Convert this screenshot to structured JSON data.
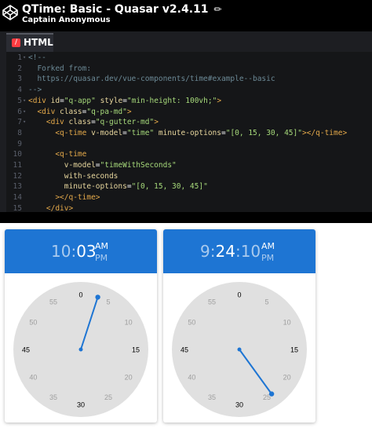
{
  "header": {
    "title": "QTime: Basic - Quasar v2.4.11",
    "author": "Captain Anonymous",
    "logo_icon": "codepen-logo-icon",
    "edit_icon": "pencil-icon"
  },
  "editor": {
    "tab_label": "HTML",
    "tab_badge": "/",
    "lines": [
      {
        "n": "1",
        "fold": true,
        "segments": [
          {
            "c": "c-comment",
            "t": "<!--"
          }
        ]
      },
      {
        "n": "2",
        "fold": false,
        "segments": [
          {
            "c": "c-comment",
            "t": "  Forked from:"
          }
        ]
      },
      {
        "n": "3",
        "fold": false,
        "segments": [
          {
            "c": "c-comment",
            "t": "  https://quasar.dev/vue-components/time#example--basic"
          }
        ]
      },
      {
        "n": "4",
        "fold": false,
        "segments": [
          {
            "c": "c-comment",
            "t": "-->"
          }
        ]
      },
      {
        "n": "5",
        "fold": true,
        "segments": [
          {
            "c": "c-tag",
            "t": "<div "
          },
          {
            "c": "c-attr",
            "t": "id"
          },
          {
            "c": "c-text",
            "t": "="
          },
          {
            "c": "c-str",
            "t": "\"q-app\""
          },
          {
            "c": "c-text",
            "t": " "
          },
          {
            "c": "c-attr",
            "t": "style"
          },
          {
            "c": "c-text",
            "t": "="
          },
          {
            "c": "c-str",
            "t": "\"min-height: 100vh;\""
          },
          {
            "c": "c-tag",
            "t": ">"
          }
        ]
      },
      {
        "n": "6",
        "fold": true,
        "segments": [
          {
            "c": "c-tag",
            "t": "  <div "
          },
          {
            "c": "c-attr",
            "t": "class"
          },
          {
            "c": "c-text",
            "t": "="
          },
          {
            "c": "c-str",
            "t": "\"q-pa-md\""
          },
          {
            "c": "c-tag",
            "t": ">"
          }
        ]
      },
      {
        "n": "7",
        "fold": true,
        "segments": [
          {
            "c": "c-tag",
            "t": "    <div "
          },
          {
            "c": "c-attr",
            "t": "class"
          },
          {
            "c": "c-text",
            "t": "="
          },
          {
            "c": "c-str",
            "t": "\"q-gutter-md\""
          },
          {
            "c": "c-tag",
            "t": ">"
          }
        ]
      },
      {
        "n": "8",
        "fold": false,
        "segments": [
          {
            "c": "c-tag",
            "t": "      <q-time "
          },
          {
            "c": "c-attr",
            "t": "v-model"
          },
          {
            "c": "c-text",
            "t": "="
          },
          {
            "c": "c-str",
            "t": "\"time\""
          },
          {
            "c": "c-text",
            "t": " "
          },
          {
            "c": "c-attr",
            "t": "minute-options"
          },
          {
            "c": "c-text",
            "t": "="
          },
          {
            "c": "c-str",
            "t": "\"[0, 15, 30, 45]\""
          },
          {
            "c": "c-tag",
            "t": "></q-time>"
          }
        ]
      },
      {
        "n": "9",
        "fold": false,
        "segments": []
      },
      {
        "n": "10",
        "fold": false,
        "segments": [
          {
            "c": "c-tag",
            "t": "      <q-time"
          }
        ]
      },
      {
        "n": "11",
        "fold": false,
        "segments": [
          {
            "c": "c-attr",
            "t": "        v-model"
          },
          {
            "c": "c-text",
            "t": "="
          },
          {
            "c": "c-str",
            "t": "\"timeWithSeconds\""
          }
        ]
      },
      {
        "n": "12",
        "fold": false,
        "segments": [
          {
            "c": "c-attr",
            "t": "        with-seconds"
          }
        ]
      },
      {
        "n": "13",
        "fold": false,
        "segments": [
          {
            "c": "c-attr",
            "t": "        minute-options"
          },
          {
            "c": "c-text",
            "t": "="
          },
          {
            "c": "c-str",
            "t": "\"[0, 15, 30, 45]\""
          }
        ]
      },
      {
        "n": "14",
        "fold": false,
        "segments": [
          {
            "c": "c-tag",
            "t": "      ></q-time>"
          }
        ]
      },
      {
        "n": "15",
        "fold": false,
        "segments": [
          {
            "c": "c-tag",
            "t": "    </div>"
          }
        ]
      }
    ]
  },
  "pickers": [
    {
      "hours": "10",
      "sep1": ":",
      "minutes": "03",
      "sep2": "",
      "seconds": "",
      "am_label": "AM",
      "pm_label": "PM",
      "selected_value": 3,
      "selectable": [
        0,
        15,
        30,
        45
      ],
      "labels": [
        "0",
        "5",
        "10",
        "15",
        "20",
        "25",
        "30",
        "35",
        "40",
        "45",
        "50",
        "55"
      ],
      "accent": "#1e75d3"
    },
    {
      "hours": "9",
      "sep1": ":",
      "minutes": "24",
      "sep2": ":",
      "seconds": "10",
      "am_label": "AM",
      "pm_label": "PM",
      "selected_value": 24,
      "selectable": [
        0,
        15,
        30,
        45
      ],
      "labels": [
        "0",
        "5",
        "10",
        "15",
        "20",
        "25",
        "30",
        "35",
        "40",
        "45",
        "50",
        "55"
      ],
      "accent": "#1e75d3"
    }
  ]
}
